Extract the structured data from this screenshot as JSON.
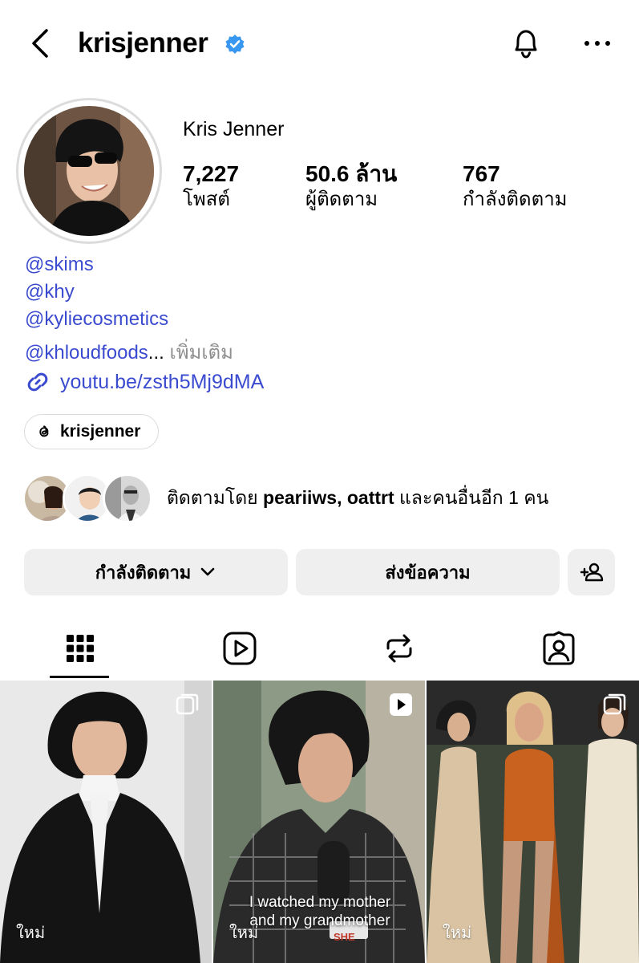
{
  "header": {
    "username": "krisjenner"
  },
  "profile": {
    "full_name": "Kris Jenner",
    "stats": [
      {
        "value": "7,227",
        "label": "โพสต์"
      },
      {
        "value": "50.6 ล้าน",
        "label": "ผู้ติดตาม"
      },
      {
        "value": "767",
        "label": "กำลังติดตาม"
      }
    ]
  },
  "bio": {
    "links": [
      "@skims",
      "@khy",
      "@kyliecosmetics",
      "@khloudfoods"
    ],
    "ellipsis": "...",
    "more_label": "เพิ่มเติม",
    "external_link": "youtu.be/zsth5Mj9dMA"
  },
  "threads": {
    "label": "krisjenner"
  },
  "followed_by": {
    "prefix": "ติดตามโดย",
    "names": "peariiws, oattrt",
    "suffix": "และคนอื่นอีก 1 คน"
  },
  "actions": {
    "following_label": "กำลังติดตาม",
    "message_label": "ส่งข้อความ"
  },
  "tabs": [
    "grid-icon",
    "reels-icon",
    "reposts-icon",
    "tagged-icon"
  ],
  "posts": [
    {
      "badge": "ใหม่",
      "type": "carousel"
    },
    {
      "badge": "ใหม่",
      "type": "reel",
      "caption_line1": "I watched my mother",
      "caption_line2": "and my grandmother",
      "mic_text": "SHE"
    },
    {
      "badge": "ใหม่",
      "type": "carousel"
    }
  ],
  "colors": {
    "link": "#3b4bd0",
    "verified": "#3897f0",
    "button_bg": "#efefef"
  }
}
